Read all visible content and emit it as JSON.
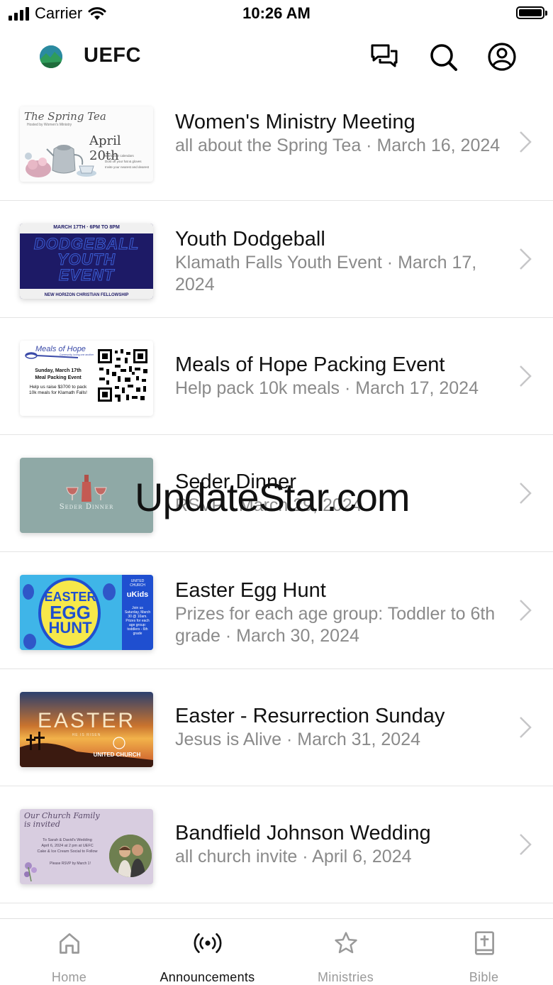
{
  "status_bar": {
    "carrier": "Carrier",
    "time": "10:26 AM"
  },
  "header": {
    "brand": "UEFC"
  },
  "events": [
    {
      "title": "Women's Ministry Meeting",
      "subtitle": "all about the Spring Tea · March 16, 2024",
      "thumb": {
        "heading": "The Spring Tea",
        "tagline": "Hosted by Women's Ministry",
        "date": "April 20th",
        "lines": [
          "Mark your calendars",
          "Dust off your hat & gloves",
          "Invite your nearest and dearest"
        ]
      }
    },
    {
      "title": "Youth Dodgeball",
      "subtitle": "Klamath Falls Youth Event · March 17, 2024",
      "thumb": {
        "top": "MARCH 17TH · 6PM TO 8PM",
        "line1": "DODGEBALL",
        "line2": "YOUTH",
        "line3": "EVENT",
        "bottom": "NEW HORIZON CHRISTIAN FELLOWSHIP"
      }
    },
    {
      "title": "Meals of Hope Packing Event",
      "subtitle": "Help pack 10k meals · March 17, 2024",
      "thumb": {
        "logo": "Meals of Hope",
        "logo_sub": "Community, loving one another",
        "head": "Sunday, March 17th",
        "head2": "Meal Packing Event",
        "body": "Help us raise $3700 to pack 10k meals for Klamath Falls!"
      }
    },
    {
      "title": "Seder Dinner",
      "subtitle": "RSVP · March 29, 2024",
      "thumb": {
        "label": "Seder Dinner"
      }
    },
    {
      "title": "Easter Egg Hunt",
      "subtitle": "Prizes for each age group: Toddler to 6th grade · March 30, 2024",
      "thumb": {
        "w1": "EASTER",
        "w2": "EGG",
        "w3": "HUNT",
        "church": "UNITED CHURCH",
        "kids": "uKids",
        "info": "Join us Saturday, March 30 @ 10am. Prizes for each age group: toddlers - 6th grade"
      }
    },
    {
      "title": "Easter - Resurrection Sunday",
      "subtitle": "Jesus is Alive · March 31, 2024",
      "thumb": {
        "word": "EASTER",
        "small": "HE IS RISEN",
        "church": "UNITED CHURCH"
      }
    },
    {
      "title": "Bandfield Johnson Wedding",
      "subtitle": "all church invite · April 6, 2024",
      "thumb": {
        "script": "Our Church Family is invited",
        "to": "To Sarah & David's Wedding",
        "when": "April 6, 2024 at 2 pm at UEFC",
        "cake": "Cake & Ice Cream Social to Follow",
        "rsvp": "Please RSVP by March 1!"
      }
    }
  ],
  "tabs": [
    {
      "label": "Home",
      "icon": "home-icon"
    },
    {
      "label": "Announcements",
      "icon": "broadcast-icon"
    },
    {
      "label": "Ministries",
      "icon": "star-icon"
    },
    {
      "label": "Bible",
      "icon": "bible-icon"
    }
  ],
  "watermark": "UpdateStar.com",
  "colors": {
    "active_tab": "#111111",
    "inactive_tab": "#9a9a9a",
    "subtitle": "#8a8a8a",
    "divider": "#e4e4e4"
  }
}
